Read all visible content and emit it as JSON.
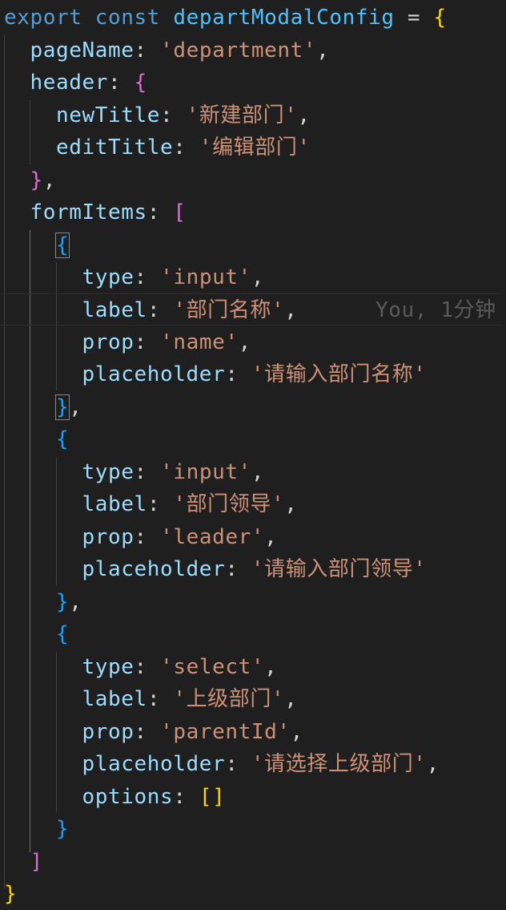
{
  "code": {
    "export_kw": "export",
    "const_kw": "const",
    "var_name": "departModalConfig",
    "eq": "=",
    "page_name_key": "pageName",
    "page_name_val": "'department'",
    "header_key": "header",
    "new_title_key": "newTitle",
    "new_title_val": "'新建部门'",
    "edit_title_key": "editTitle",
    "edit_title_val": "'编辑部门'",
    "form_items_key": "formItems",
    "items": [
      {
        "type_key": "type",
        "type_val": "'input'",
        "label_key": "label",
        "label_val": "'部门名称'",
        "prop_key": "prop",
        "prop_val": "'name'",
        "placeholder_key": "placeholder",
        "placeholder_val": "'请输入部门名称'"
      },
      {
        "type_key": "type",
        "type_val": "'input'",
        "label_key": "label",
        "label_val": "'部门领导'",
        "prop_key": "prop",
        "prop_val": "'leader'",
        "placeholder_key": "placeholder",
        "placeholder_val": "'请输入部门领导'"
      },
      {
        "type_key": "type",
        "type_val": "'select'",
        "label_key": "label",
        "label_val": "'上级部门'",
        "prop_key": "prop",
        "prop_val": "'parentId'",
        "placeholder_key": "placeholder",
        "placeholder_val": "'请选择上级部门'",
        "options_key": "options"
      }
    ],
    "blame_annotation": "You, 1分钟"
  },
  "colors": {
    "background": "#1f1f1f",
    "keyword": "#569cd6",
    "constant": "#4fc1ff",
    "property": "#9cdcfe",
    "string": "#ce9178",
    "bracket_level_1": "#ffd700",
    "bracket_level_2": "#da70d6",
    "bracket_level_3": "#179fff"
  }
}
